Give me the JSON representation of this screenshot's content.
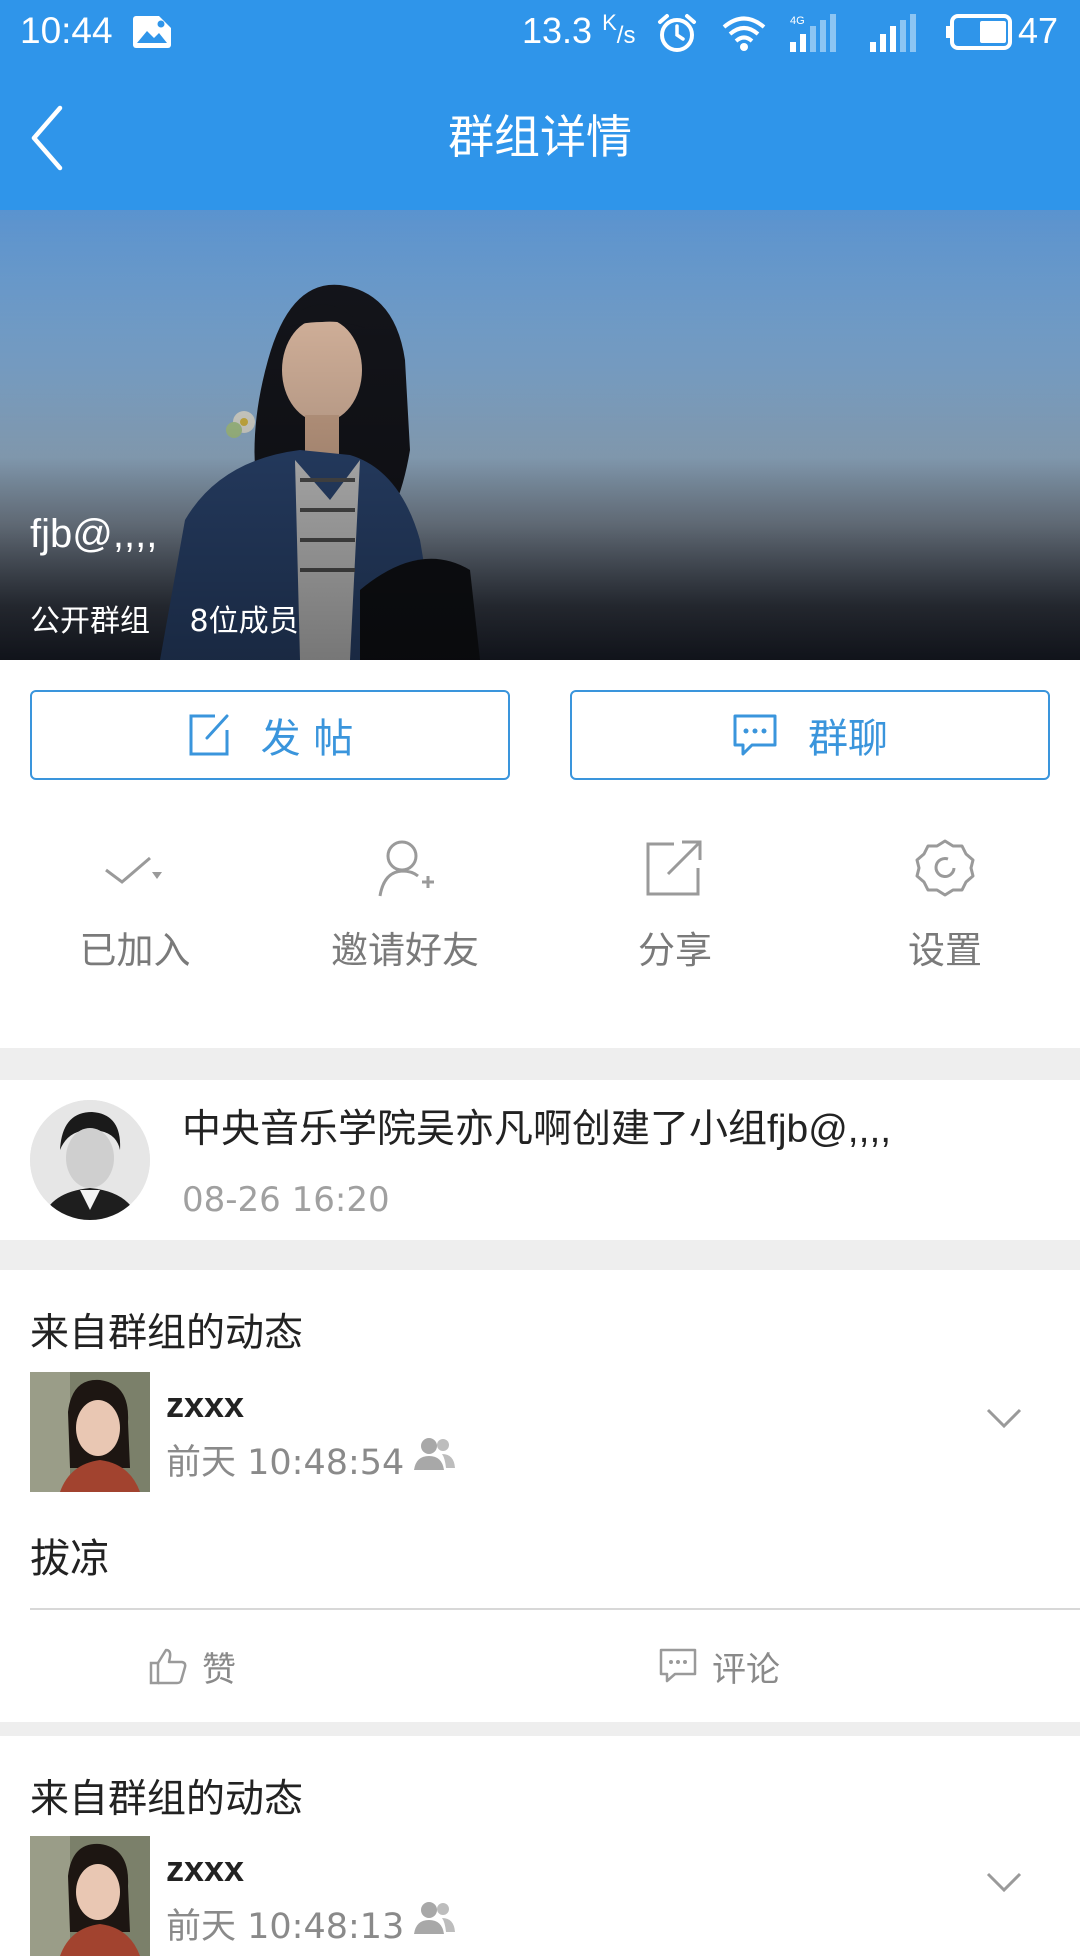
{
  "status_bar": {
    "time": "10:44",
    "net_speed": "13.3",
    "net_speed_unit": "K/s",
    "net_speed_unit_sup": "K",
    "net_speed_unit_sub": "/s",
    "network_type": "4G",
    "battery": "47"
  },
  "header": {
    "title": "群组详情"
  },
  "group": {
    "name": "fjb@,,,,",
    "type": "公开群组",
    "members": "8位成员"
  },
  "actions": {
    "post_label": "发 帖",
    "chat_label": "群聊"
  },
  "quick_actions": [
    {
      "label": "已加入"
    },
    {
      "label": "邀请好友"
    },
    {
      "label": "分享"
    },
    {
      "label": "设置"
    }
  ],
  "creation": {
    "text": "中央音乐学院吴亦凡啊创建了小组fjb@,,,,",
    "time": "08-26 16:20"
  },
  "feed": [
    {
      "section_title": "来自群组的动态",
      "user": "zxxx",
      "time": "前天 10:48:54",
      "content": "拔凉",
      "like_label": "赞",
      "comment_label": "评论"
    },
    {
      "section_title": "来自群组的动态",
      "user": "zxxx",
      "time": "前天 10:48:13"
    }
  ],
  "colors": {
    "brand": "#2f95ea",
    "accent": "#3a95dc",
    "separator": "#eeeeee"
  }
}
